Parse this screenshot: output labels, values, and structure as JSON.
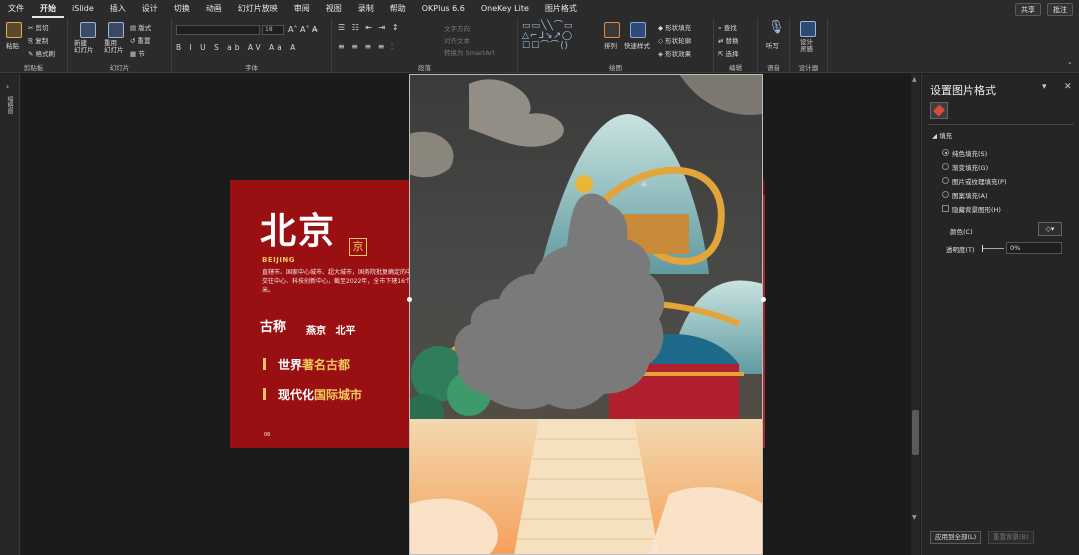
{
  "menu": {
    "tabs": [
      "文件",
      "开始",
      "iSlide",
      "插入",
      "设计",
      "切换",
      "动画",
      "幻灯片放映",
      "审阅",
      "视图",
      "录制",
      "帮助",
      "OKPlus 6.6",
      "OneKey Lite",
      "图片格式"
    ],
    "active_tab": "开始",
    "share": "共享",
    "comment": "批注"
  },
  "ribbon": {
    "clipboard": {
      "paste": "粘贴",
      "cut": "剪切",
      "copy": "复制",
      "format_painter": "格式刷",
      "group": "剪贴板"
    },
    "slides": {
      "new_slide": "新建\n幻灯片",
      "reuse_slide": "重用\n幻灯片",
      "layout": "版式",
      "reset": "重置",
      "section": "节",
      "group": "幻灯片"
    },
    "font": {
      "font_name": "",
      "font_size": "18",
      "group": "字体"
    },
    "paragraph": {
      "text_direction": "文字方向",
      "align_text": "对齐文本",
      "smartart": "转换为 SmartArt",
      "group": "段落"
    },
    "drawing": {
      "arrange": "排列",
      "quick_styles": "快速样式",
      "shape_fill": "形状填充",
      "shape_outline": "形状轮廓",
      "shape_effects": "形状效果",
      "group": "绘图"
    },
    "editing": {
      "find": "查找",
      "replace": "替换",
      "select": "选择",
      "group": "编辑"
    },
    "voice": {
      "dictate": "听写",
      "group": "语音"
    },
    "designer": {
      "design_ideas": "设计\n灵感",
      "group": "设计器"
    }
  },
  "left_strip": {
    "label": "缩略图"
  },
  "slide": {
    "title": "北京",
    "seal": "京",
    "subtitle": "BEIJING",
    "description": "直辖市、国家中心城市、超大城市，国务院批复确定的中国政治中心、文化中心、国际交往中心、科技创新中心，截至2022年，全市下辖16个区，总面积16410.54平方千米。",
    "gucheng": "古称",
    "old_names": "燕京 北平",
    "bullets": [
      {
        "white": "世界",
        "gold": "著名古都"
      },
      {
        "white": "现代化",
        "gold": "国际城市"
      }
    ],
    "page_number": "06"
  },
  "panel": {
    "title": "设置图片格式",
    "section": "填充",
    "options": [
      "纯色填充(S)",
      "渐变填充(G)",
      "图片或纹理填充(P)",
      "图案填充(A)"
    ],
    "selected_option": "纯色填充(S)",
    "hide_bg": "隐藏背景图形(H)",
    "color_label": "颜色(C)",
    "transparency_label": "透明度(T)",
    "transparency_value": "0%",
    "apply_all": "应用到全部(L)",
    "reset_bg": "重置背景(B)"
  },
  "colors": {
    "accent_red": "#9a0f12",
    "gold": "#f2c75f",
    "map_gray": "#7a7a7a"
  }
}
